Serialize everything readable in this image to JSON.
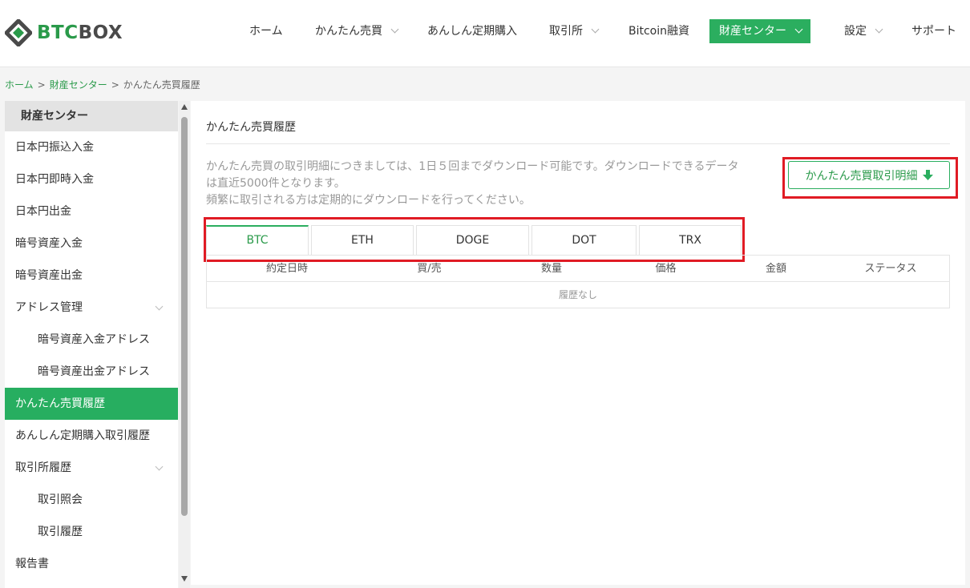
{
  "header": {
    "logo_btc": "BTC",
    "logo_box": "BOX",
    "nav": [
      {
        "label": "ホーム",
        "has_dropdown": false
      },
      {
        "label": "かんたん売買",
        "has_dropdown": true
      },
      {
        "label": "あんしん定期購入",
        "has_dropdown": false
      },
      {
        "label": "取引所",
        "has_dropdown": true
      },
      {
        "label": "Bitcoin融資",
        "has_dropdown": false
      },
      {
        "label": "財産センター",
        "has_dropdown": true,
        "active": true
      },
      {
        "label": "設定",
        "has_dropdown": true
      },
      {
        "label": "サポート",
        "has_dropdown": false
      }
    ]
  },
  "breadcrumb": {
    "items": [
      "ホーム",
      "財産センター",
      "かんたん売買履歴"
    ],
    "separator": ">"
  },
  "sidebar": {
    "title": "財産センター",
    "items": [
      {
        "label": "日本円振込入金"
      },
      {
        "label": "日本円即時入金"
      },
      {
        "label": "日本円出金"
      },
      {
        "label": "暗号資産入金"
      },
      {
        "label": "暗号資産出金"
      },
      {
        "label": "アドレス管理",
        "has_dropdown": true
      },
      {
        "label": "暗号資産入金アドレス",
        "sub": true
      },
      {
        "label": "暗号資産出金アドレス",
        "sub": true
      },
      {
        "label": "かんたん売買履歴",
        "active": true
      },
      {
        "label": "あんしん定期購入取引履歴"
      },
      {
        "label": "取引所履歴",
        "has_dropdown": true
      },
      {
        "label": "取引照会",
        "sub": true
      },
      {
        "label": "取引履歴",
        "sub": true
      },
      {
        "label": "報告書"
      }
    ]
  },
  "main": {
    "title": "かんたん売買履歴",
    "notice_line1": "かんたん売買の取引明細につきましては、1日５回までダウンロード可能です。ダウンロードできるデータ",
    "notice_line2": "は直近5000件となります。",
    "notice_line3": "頻繁に取引される方は定期的にダウンロードを行ってください。",
    "download_button": "かんたん売買取引明細",
    "tabs": [
      "BTC",
      "ETH",
      "DOGE",
      "DOT",
      "TRX"
    ],
    "active_tab": "BTC",
    "table": {
      "columns": [
        "約定日時",
        "買/売",
        "数量",
        "価格",
        "金額",
        "ステータス"
      ],
      "empty_text": "履歴なし"
    }
  },
  "colors": {
    "accent": "#2bae5f",
    "highlight": "#e01b24"
  }
}
